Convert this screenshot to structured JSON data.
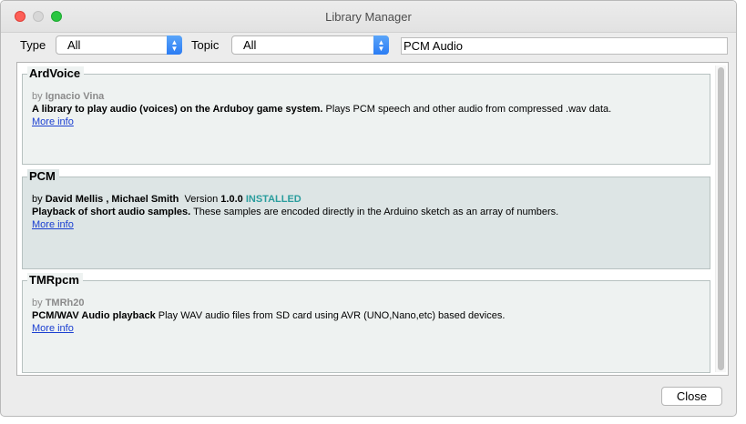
{
  "window": {
    "title": "Library Manager"
  },
  "filters": {
    "type_label": "Type",
    "type_value": "All",
    "topic_label": "Topic",
    "topic_value": "All",
    "search_value": "PCM Audio"
  },
  "libraries": [
    {
      "name": "ArdVoice",
      "by": "by",
      "author": "Ignacio Vina",
      "summary": "A library to play audio (voices) on the Arduboy game system.",
      "description": " Plays PCM speech and other audio from compressed .wav data.",
      "more_info": "More info"
    },
    {
      "name": "PCM",
      "by": "by",
      "author": "David Mellis , Michael Smith",
      "version_label": "Version",
      "version": "1.0.0",
      "status": "INSTALLED",
      "summary": "Playback of short audio samples.",
      "description": " These samples are encoded directly in the Arduino sketch as an array of numbers.",
      "more_info": "More info"
    },
    {
      "name": "TMRpcm",
      "by": "by",
      "author": "TMRh20",
      "summary": "PCM/WAV Audio playback",
      "description": " Play WAV audio files from SD card using AVR (UNO,Nano,etc) based devices.",
      "more_info": "More info"
    }
  ],
  "buttons": {
    "close": "Close"
  },
  "colors": {
    "installed": "#2a9d9d",
    "link": "#1a3fd1",
    "select_arrow": "#2b7cf4"
  }
}
